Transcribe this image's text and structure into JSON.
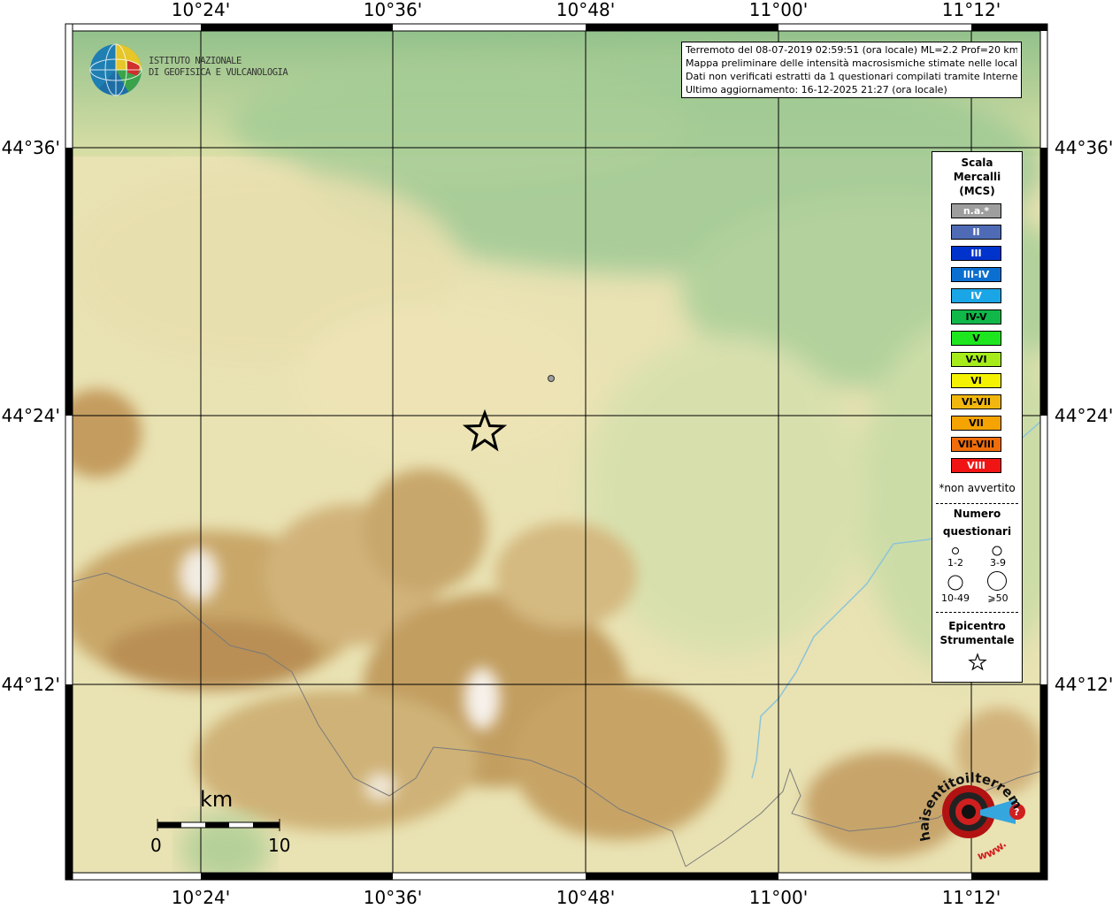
{
  "map": {
    "x_labels": [
      "10°24'",
      "10°36'",
      "10°48'",
      "11°00'",
      "11°12'"
    ],
    "y_labels": [
      "44°36'",
      "44°24'",
      "44°12'"
    ]
  },
  "info": {
    "line1": "Terremoto del 08-07-2019 02:59:51 (ora locale) ML=2.2 Prof=20 km",
    "line2": "Mappa preliminare delle intensità macrosismiche stimate nelle località",
    "line3": "Dati non verificati estratti da 1 questionari compilati tramite Internet.",
    "line4": "Ultimo aggiornamento: 16-12-2025 21:27 (ora locale)"
  },
  "ingv": {
    "line1": "ISTITUTO NAZIONALE",
    "line2": "DI GEOFISICA E VULCANOLOGIA"
  },
  "legend": {
    "title1": "Scala",
    "title2": "Mercalli",
    "title3": "(MCS)",
    "classes": [
      {
        "label": "n.a.*",
        "color": "#9e9e9e"
      },
      {
        "label": "II",
        "color": "#4f6bb5"
      },
      {
        "label": "III",
        "color": "#0033cc"
      },
      {
        "label": "III-IV",
        "color": "#0a6fd0"
      },
      {
        "label": "IV",
        "color": "#1aa6e6"
      },
      {
        "label": "IV-V",
        "color": "#10b84a"
      },
      {
        "label": "V",
        "color": "#1ee61e"
      },
      {
        "label": "V-VI",
        "color": "#a6ec1a"
      },
      {
        "label": "VI",
        "color": "#f4f200"
      },
      {
        "label": "VI-VII",
        "color": "#f1b70f"
      },
      {
        "label": "VII",
        "color": "#f4a300"
      },
      {
        "label": "VII-VIII",
        "color": "#f06d0a"
      },
      {
        "label": "VIII",
        "color": "#f01414"
      }
    ],
    "note": "*non avvertito",
    "count_title1": "Numero",
    "count_title2": "questionari",
    "size1": "1-2",
    "size2": "3-9",
    "size3": "10-49",
    "size4": "⩾50",
    "epi_title1": "Epicentro",
    "epi_title2": "Strumentale"
  },
  "scale": {
    "unit": "km",
    "start": "0",
    "end": "10"
  },
  "badge": {
    "text": "haisentitoilterremoto.it",
    "url": "www."
  }
}
